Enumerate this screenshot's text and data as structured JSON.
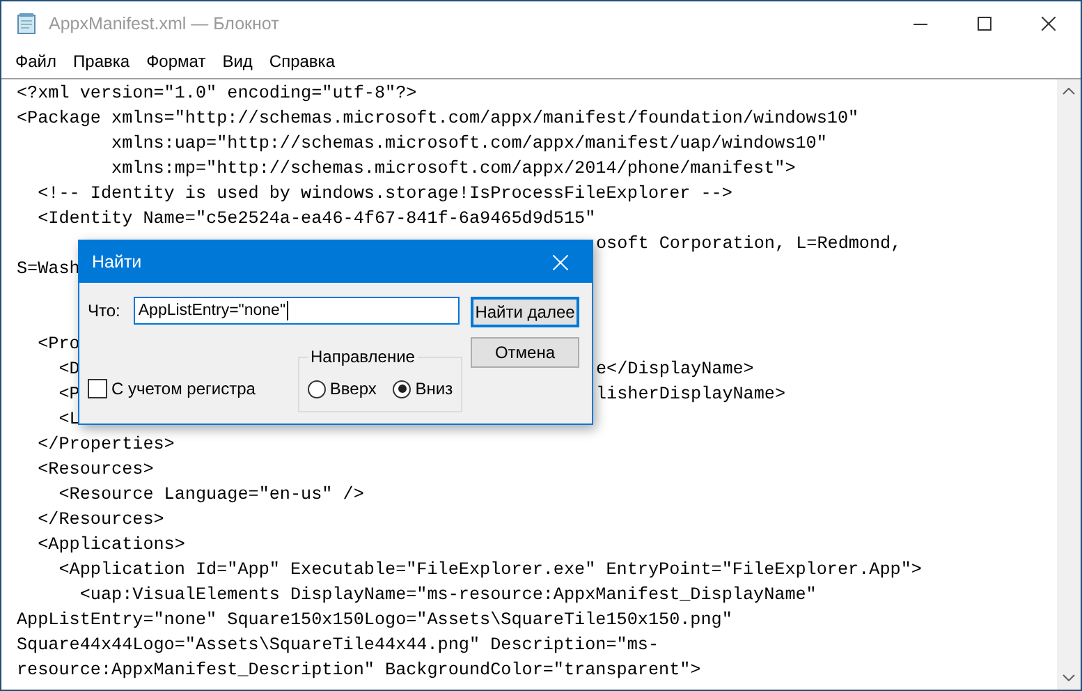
{
  "window": {
    "title": "AppxManifest.xml — Блокнот"
  },
  "menu": [
    "Файл",
    "Правка",
    "Формат",
    "Вид",
    "Справка"
  ],
  "editor": {
    "lines": [
      {
        "text": "<?xml version=\"1.0\" encoding=\"utf-8\"?>"
      },
      {
        "text": "<Package xmlns=\"http://schemas.microsoft.com/appx/manifest/foundation/windows10\""
      },
      {
        "text": "         xmlns:uap=\"http://schemas.microsoft.com/appx/manifest/uap/windows10\""
      },
      {
        "text": "         xmlns:mp=\"http://schemas.microsoft.com/appx/2014/phone/manifest\">"
      },
      {
        "text": "  <!-- Identity is used by windows.storage!IsProcessFileExplorer -->"
      },
      {
        "text": "  <Identity Name=\"c5e2524a-ea46-4f67-841f-6a9465d9d515\""
      },
      {
        "tail": "osoft Corporation, L=Redmond,"
      },
      {
        "text": "S=Wash"
      }
    ],
    "lines_below": [
      {
        "text": "  <Pro"
      },
      {
        "text": "    <D",
        "tail": "e</DisplayName>"
      },
      {
        "text": "    <P",
        "tail": "lisherDisplayName>"
      },
      {
        "text": "    <L"
      },
      {
        "text": "  </Properties>"
      },
      {
        "text": "  <Resources>"
      },
      {
        "text": "    <Resource Language=\"en-us\" />"
      },
      {
        "text": "  </Resources>"
      },
      {
        "text": "  <Applications>"
      },
      {
        "text": "    <Application Id=\"App\" Executable=\"FileExplorer.exe\" EntryPoint=\"FileExplorer.App\">"
      },
      {
        "text": "      <uap:VisualElements DisplayName=\"ms-resource:AppxManifest_DisplayName\""
      },
      {
        "text": "AppListEntry=\"none\" Square150x150Logo=\"Assets\\SquareTile150x150.png\""
      },
      {
        "text": "Square44x44Logo=\"Assets\\SquareTile44x44.png\" Description=\"ms-"
      },
      {
        "text": "resource:AppxManifest_Description\" BackgroundColor=\"transparent\">"
      }
    ]
  },
  "find_dialog": {
    "title": "Найти",
    "find_label": "Что:",
    "find_value": "AppListEntry=\"none\"",
    "find_next_button": "Найти далее",
    "cancel_button": "Отмена",
    "direction": {
      "label": "Направление",
      "options": [
        {
          "label": "Вверх",
          "selected": false
        },
        {
          "label": "Вниз",
          "selected": true
        }
      ]
    },
    "match_case": {
      "label": "С учетом регистра",
      "checked": false
    }
  }
}
